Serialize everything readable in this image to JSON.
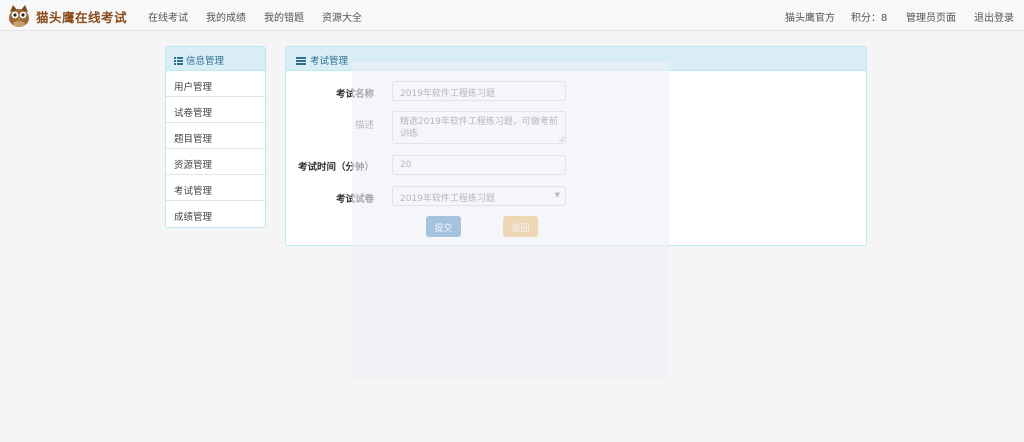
{
  "navbar": {
    "brand": "猫头鹰在线考试",
    "links": [
      "在线考试",
      "我的成绩",
      "我的错题",
      "资源大全"
    ],
    "user": "猫头鹰官方",
    "points": "积分：8",
    "admin": "管理员页面",
    "logout": "退出登录"
  },
  "sidebar": {
    "title": "信息管理",
    "items": [
      "用户管理",
      "试卷管理",
      "题目管理",
      "资源管理",
      "考试管理",
      "成绩管理"
    ]
  },
  "panel": {
    "title": "考试管理",
    "fields": {
      "name_label": "考试名称",
      "name_value": "2019年软件工程练习题",
      "desc_label": "描述",
      "desc_value": "精选2019年软件工程练习题，可做考前训练",
      "time_label": "考试时间（分钟）",
      "time_value": "20",
      "paper_label": "考试试卷",
      "paper_value": "2019年软件工程练习题"
    },
    "submit": "提交",
    "back": "返回"
  },
  "colors": {
    "brand": "#8a4b1c",
    "header_bg": "#d9edf7",
    "header_text": "#31708f",
    "primary": "#337ab7",
    "warning": "#f0ad4e"
  },
  "icons": {
    "logo": "owl-logo-icon",
    "sidebar": "list-icon",
    "panel": "bars-icon",
    "select": "caret-down-icon"
  }
}
